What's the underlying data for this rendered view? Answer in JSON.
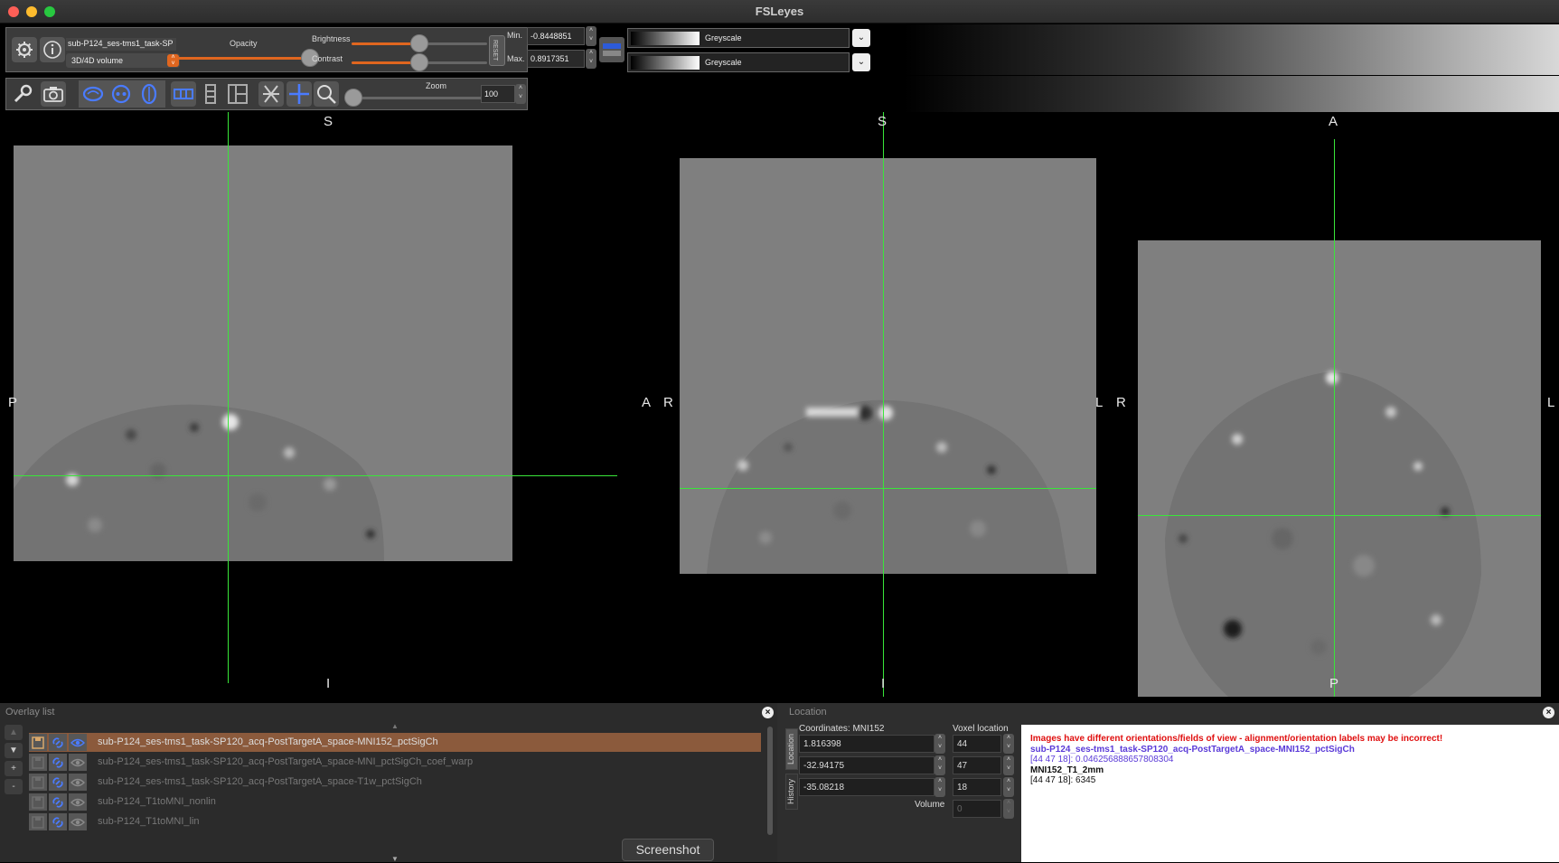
{
  "window": {
    "title": "FSLeyes"
  },
  "toolbar": {
    "overlay_name": "sub-P124_ses-tms1_task-SP",
    "overlay_type": "3D/4D volume",
    "opacity_label": "Opacity",
    "brightness_label": "Brightness",
    "contrast_label": "Contrast",
    "reset_label": "RESET",
    "min_label": "Min.",
    "max_label": "Max.",
    "min_value": "-0.8448851",
    "max_value": "0.8917351",
    "cmap1": "Greyscale",
    "cmap2": "Greyscale",
    "opacity_level": 1.0,
    "brightness_level": 0.5,
    "contrast_level": 0.5
  },
  "viewtoolbar": {
    "zoom_label": "Zoom",
    "zoom_value": "100",
    "zoom_level": 0.0
  },
  "views": {
    "sagittal": {
      "top": "S",
      "bottom": "I",
      "left": "P",
      "right": "A"
    },
    "coronal": {
      "top": "S",
      "bottom": "I",
      "left": "R",
      "right": "L"
    },
    "axial": {
      "top": "A",
      "bottom": "P",
      "left": "R",
      "right": "L"
    }
  },
  "overlay_list": {
    "title": "Overlay list",
    "items": [
      {
        "name": "sub-P124_ses-tms1_task-SP120_acq-PostTargetA_space-MNI152_pctSigCh",
        "selected": true
      },
      {
        "name": "sub-P124_ses-tms1_task-SP120_acq-PostTargetA_space-MNI_pctSigCh_coef_warp",
        "selected": false
      },
      {
        "name": "sub-P124_ses-tms1_task-SP120_acq-PostTargetA_space-T1w_pctSigCh",
        "selected": false
      },
      {
        "name": "sub-P124_T1toMNI_nonlin",
        "selected": false
      },
      {
        "name": "sub-P124_T1toMNI_lin",
        "selected": false
      }
    ],
    "screenshot_label": "Screenshot"
  },
  "location": {
    "title": "Location",
    "tab_location": "Location",
    "tab_history": "History",
    "coords_label": "Coordinates: MNI152",
    "voxel_label": "Voxel location",
    "x": "1.816398",
    "y": "-32.94175",
    "z": "-35.08218",
    "vx": "44",
    "vy": "47",
    "vz": "18",
    "volume_label": "Volume",
    "volume_value": "0",
    "info": {
      "warning": "Images have different orientations/fields of view - alignment/orientation labels may be incorrect!",
      "overlay1_name": "sub-P124_ses-tms1_task-SP120_acq-PostTargetA_space-MNI152_pctSigCh",
      "overlay1_value": "[44 47 18]: 0.046256888657808304",
      "overlay2_name": "MNI152_T1_2mm",
      "overlay2_value": "[44 47 18]: 6345"
    }
  },
  "colors": {
    "accent": "#e0661f",
    "cursor": "#39e639",
    "selected_row": "#8b5a3c",
    "warning": "#e01010",
    "overlay_info": "#5a3ad8"
  }
}
